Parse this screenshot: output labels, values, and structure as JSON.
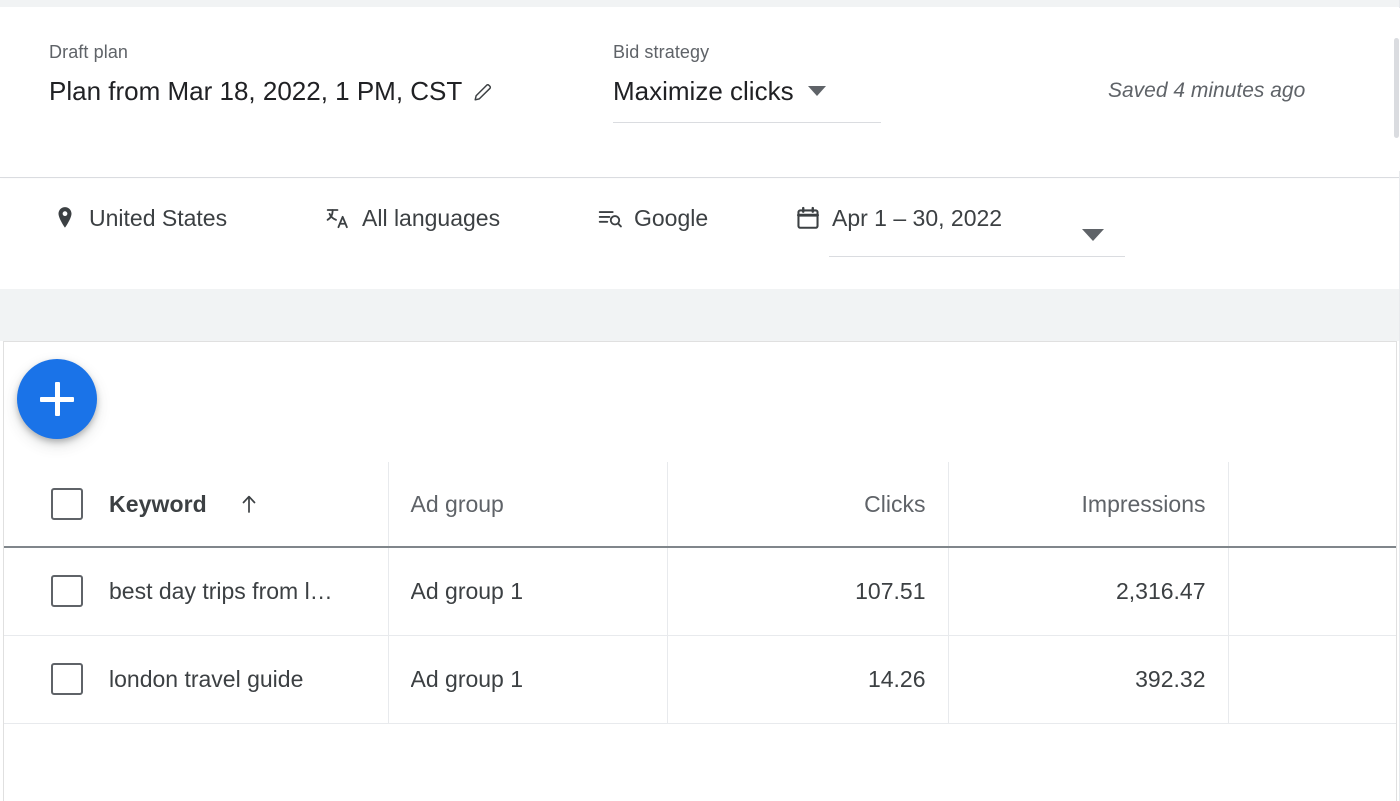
{
  "header": {
    "draft_plan": {
      "label": "Draft plan",
      "value": "Plan from Mar 18, 2022, 1 PM, CST",
      "edit_icon": "pencil-icon"
    },
    "bid_strategy": {
      "label": "Bid strategy",
      "value": "Maximize clicks",
      "dropdown_icon": "chevron-down-icon"
    },
    "saved_status": "Saved 4 minutes ago"
  },
  "filters": {
    "location": {
      "label": "United States",
      "icon": "location-pin-icon"
    },
    "language": {
      "label": "All languages",
      "icon": "translate-icon"
    },
    "network": {
      "label": "Google",
      "icon": "search-list-icon"
    },
    "date_range": {
      "label": "Apr 1 – 30, 2022",
      "icon": "calendar-icon",
      "dropdown_icon": "chevron-down-icon"
    }
  },
  "toolbar": {
    "add_button_label": "+",
    "add_button_icon": "plus-icon",
    "accent_color": "#1a73e8"
  },
  "table": {
    "columns": [
      {
        "id": "keyword",
        "label": "Keyword",
        "align": "left",
        "sorted": true,
        "sort_icon": "sort-ascending-arrow-icon"
      },
      {
        "id": "ad_group",
        "label": "Ad group",
        "align": "left"
      },
      {
        "id": "clicks",
        "label": "Clicks",
        "align": "right"
      },
      {
        "id": "impressions",
        "label": "Impressions",
        "align": "right"
      },
      {
        "id": "extra",
        "label": "",
        "align": "right"
      }
    ],
    "select_all": {
      "checked": false,
      "name": "select-all-checkbox"
    },
    "rows": [
      {
        "checked": false,
        "keyword": "best day trips from l…",
        "ad_group": "Ad group 1",
        "clicks": "107.51",
        "impressions": "2,316.47",
        "extra": ""
      },
      {
        "checked": false,
        "keyword": "london travel guide",
        "ad_group": "Ad group 1",
        "clicks": "14.26",
        "impressions": "392.32",
        "extra": ""
      }
    ]
  }
}
